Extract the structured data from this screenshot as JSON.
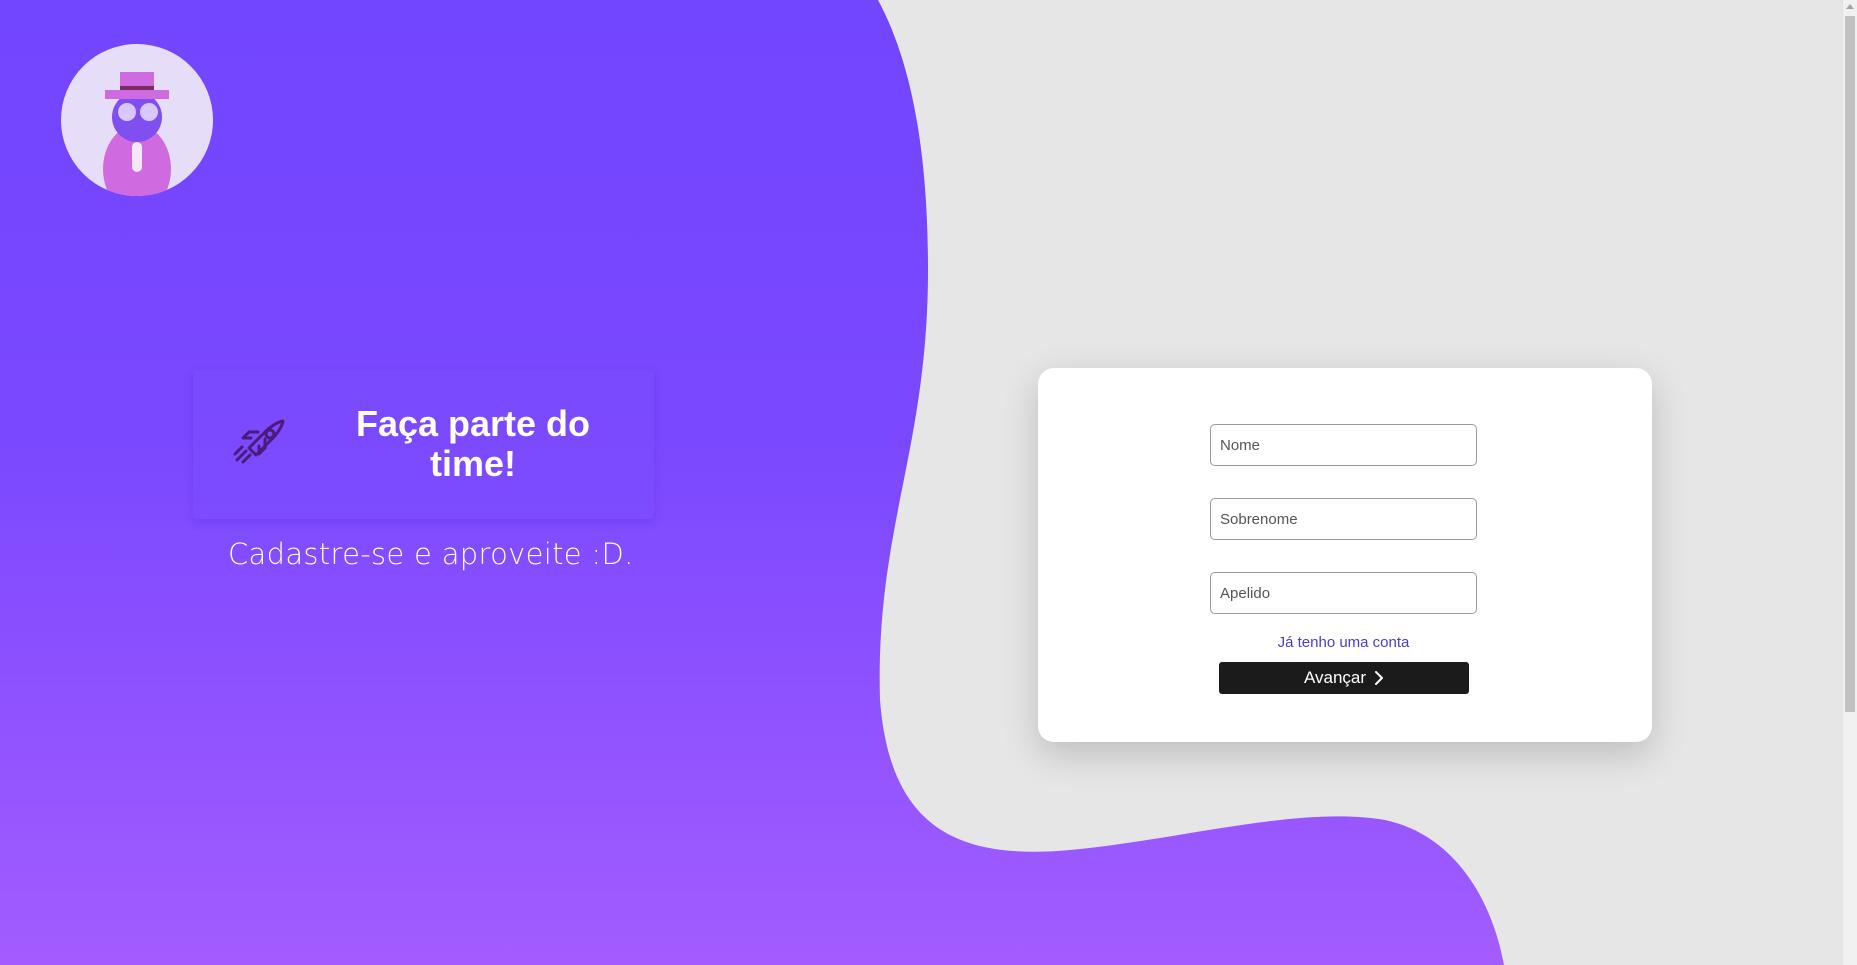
{
  "hero": {
    "title": "Faça parte do time!",
    "subtitle": "Cadastre-se e aproveite :D."
  },
  "form": {
    "nome_placeholder": "Nome",
    "sobrenome_placeholder": "Sobrenome",
    "apelido_placeholder": "Apelido",
    "login_link": "Já tenho uma conta",
    "next_button": "Avançar"
  },
  "icons": {
    "logo": "avatar-icon",
    "hero": "rocket-icon",
    "button": "chevron-right-icon"
  },
  "colors": {
    "gradient_top": "#7245ff",
    "gradient_bottom": "#a35cff",
    "background": "#e6e6e6",
    "button": "#1b1b1b",
    "link": "#4a3bd6"
  }
}
